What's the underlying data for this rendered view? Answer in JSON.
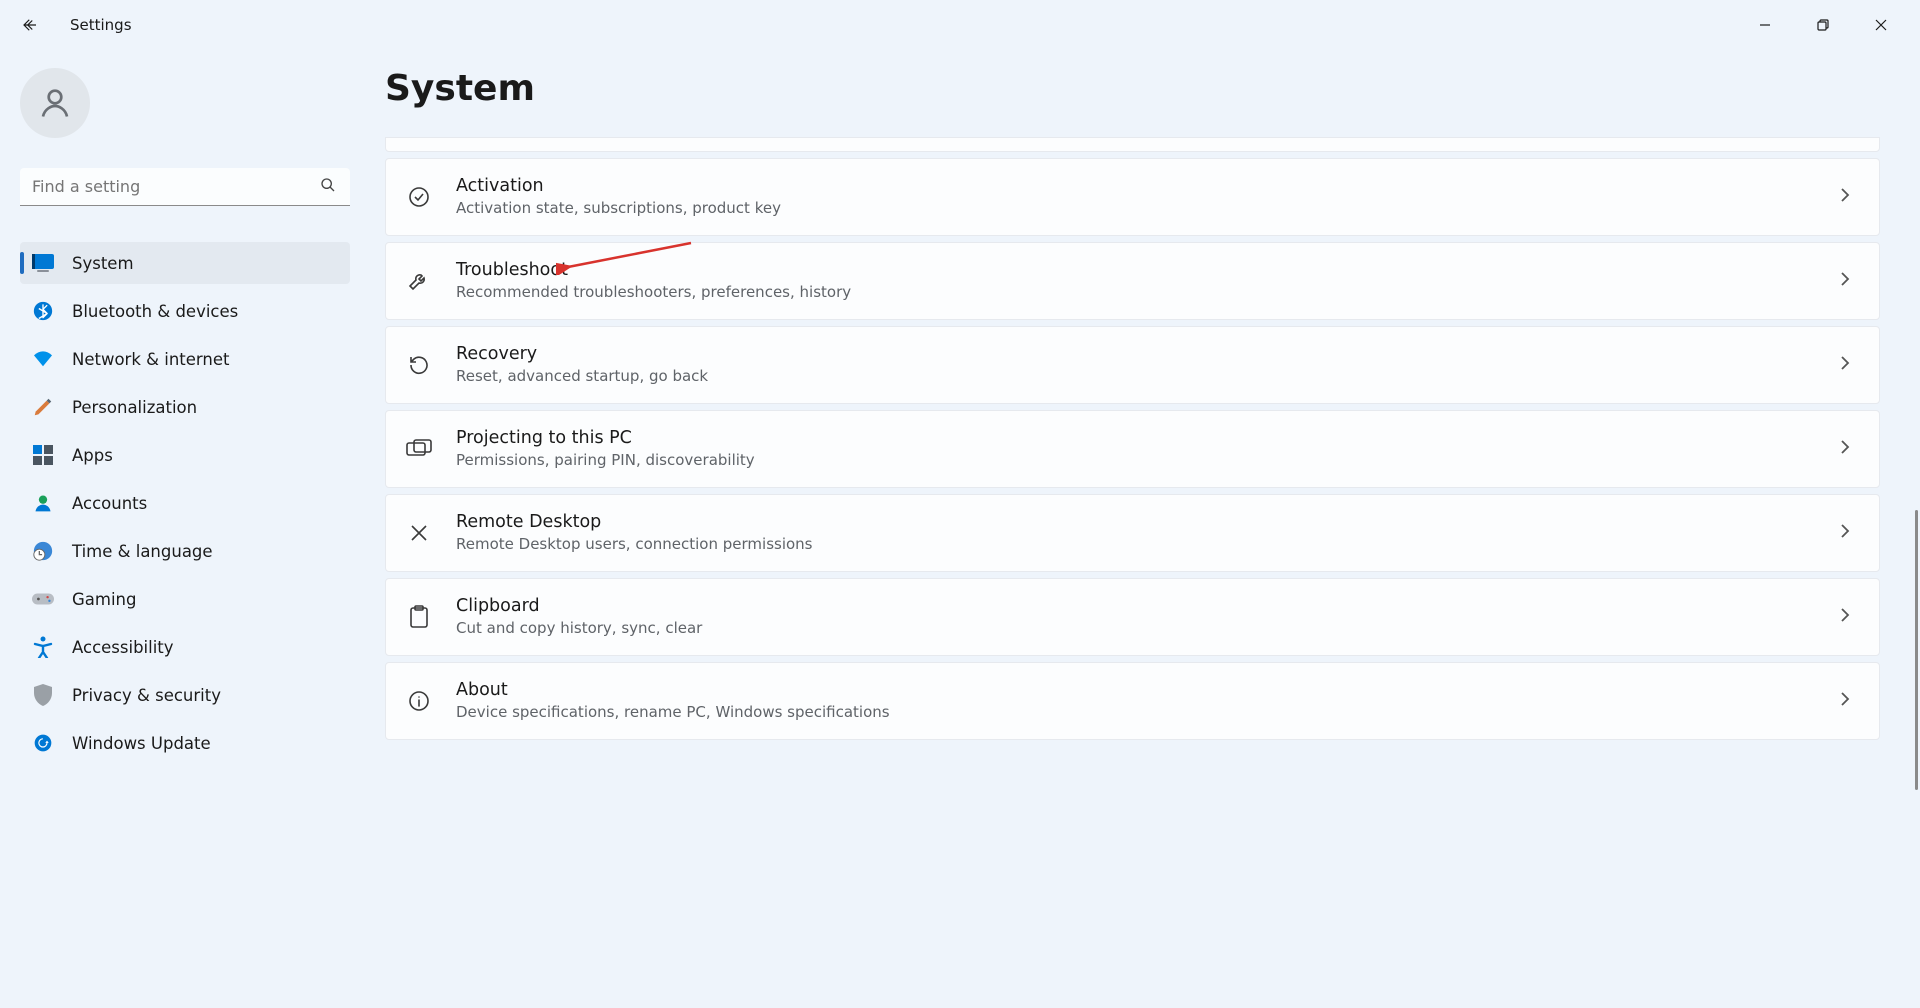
{
  "window": {
    "title": "Settings"
  },
  "search": {
    "placeholder": "Find a setting"
  },
  "sidebar": {
    "items": [
      {
        "label": "System"
      },
      {
        "label": "Bluetooth & devices"
      },
      {
        "label": "Network & internet"
      },
      {
        "label": "Personalization"
      },
      {
        "label": "Apps"
      },
      {
        "label": "Accounts"
      },
      {
        "label": "Time & language"
      },
      {
        "label": "Gaming"
      },
      {
        "label": "Accessibility"
      },
      {
        "label": "Privacy & security"
      },
      {
        "label": "Windows Update"
      }
    ]
  },
  "page": {
    "title": "System",
    "cards": [
      {
        "title": "Activation",
        "desc": "Activation state, subscriptions, product key"
      },
      {
        "title": "Troubleshoot",
        "desc": "Recommended troubleshooters, preferences, history"
      },
      {
        "title": "Recovery",
        "desc": "Reset, advanced startup, go back"
      },
      {
        "title": "Projecting to this PC",
        "desc": "Permissions, pairing PIN, discoverability"
      },
      {
        "title": "Remote Desktop",
        "desc": "Remote Desktop users, connection permissions"
      },
      {
        "title": "Clipboard",
        "desc": "Cut and copy history, sync, clear"
      },
      {
        "title": "About",
        "desc": "Device specifications, rename PC, Windows specifications"
      }
    ]
  }
}
